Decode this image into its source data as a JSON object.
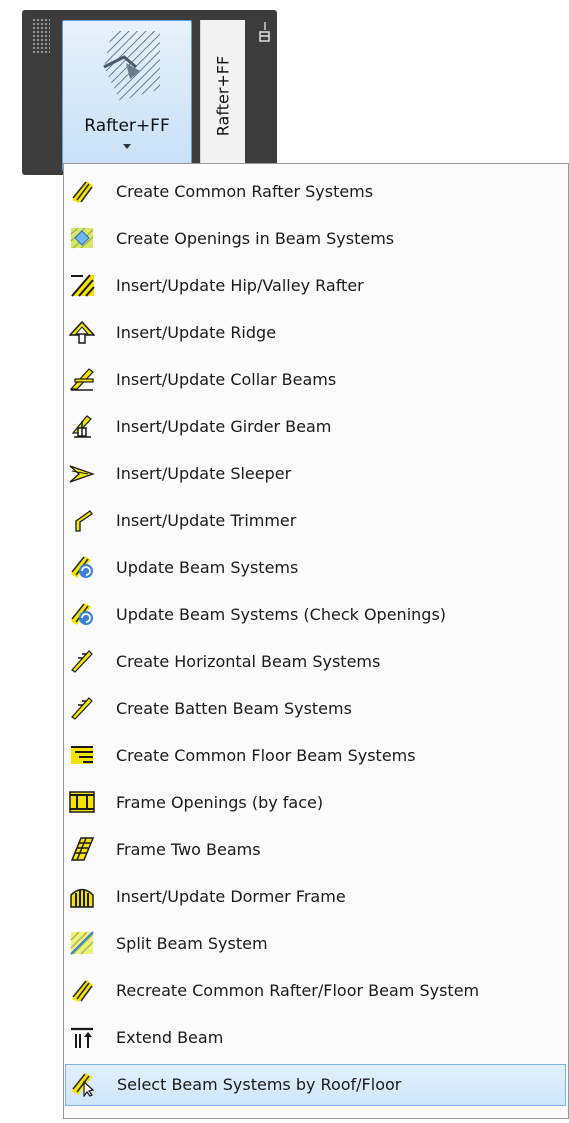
{
  "ribbon": {
    "main_button_label": "Rafter+FF",
    "side_tab_label": "Rafter+FF"
  },
  "menu": {
    "items": [
      {
        "label": "Create Common Rafter Systems",
        "icon": "rafter-system-icon"
      },
      {
        "label": "Create Openings in Beam Systems",
        "icon": "beam-opening-icon"
      },
      {
        "label": "Insert/Update Hip/Valley Rafter",
        "icon": "hip-valley-rafter-icon"
      },
      {
        "label": "Insert/Update Ridge",
        "icon": "ridge-icon"
      },
      {
        "label": "Insert/Update Collar Beams",
        "icon": "collar-beam-icon"
      },
      {
        "label": "Insert/Update Girder Beam",
        "icon": "girder-beam-icon"
      },
      {
        "label": "Insert/Update Sleeper",
        "icon": "sleeper-icon"
      },
      {
        "label": "Insert/Update Trimmer",
        "icon": "trimmer-icon"
      },
      {
        "label": "Update Beam Systems",
        "icon": "update-beam-systems-icon"
      },
      {
        "label": "Update Beam Systems (Check Openings)",
        "icon": "update-beam-systems-check-icon"
      },
      {
        "label": "Create Horizontal Beam Systems",
        "icon": "horizontal-beam-icon"
      },
      {
        "label": "Create Batten Beam Systems",
        "icon": "batten-beam-icon"
      },
      {
        "label": "Create Common Floor Beam Systems",
        "icon": "floor-beam-icon"
      },
      {
        "label": "Frame Openings (by face)",
        "icon": "frame-openings-icon"
      },
      {
        "label": "Frame Two Beams",
        "icon": "frame-two-beams-icon"
      },
      {
        "label": "Insert/Update Dormer Frame",
        "icon": "dormer-frame-icon"
      },
      {
        "label": "Split Beam System",
        "icon": "split-beam-icon"
      },
      {
        "label": "Recreate Common Rafter/Floor Beam System",
        "icon": "recreate-beam-system-icon"
      },
      {
        "label": "Extend Beam",
        "icon": "extend-beam-icon"
      },
      {
        "label": "Select Beam Systems by Roof/Floor",
        "icon": "select-beam-systems-icon",
        "selected": true
      }
    ]
  }
}
